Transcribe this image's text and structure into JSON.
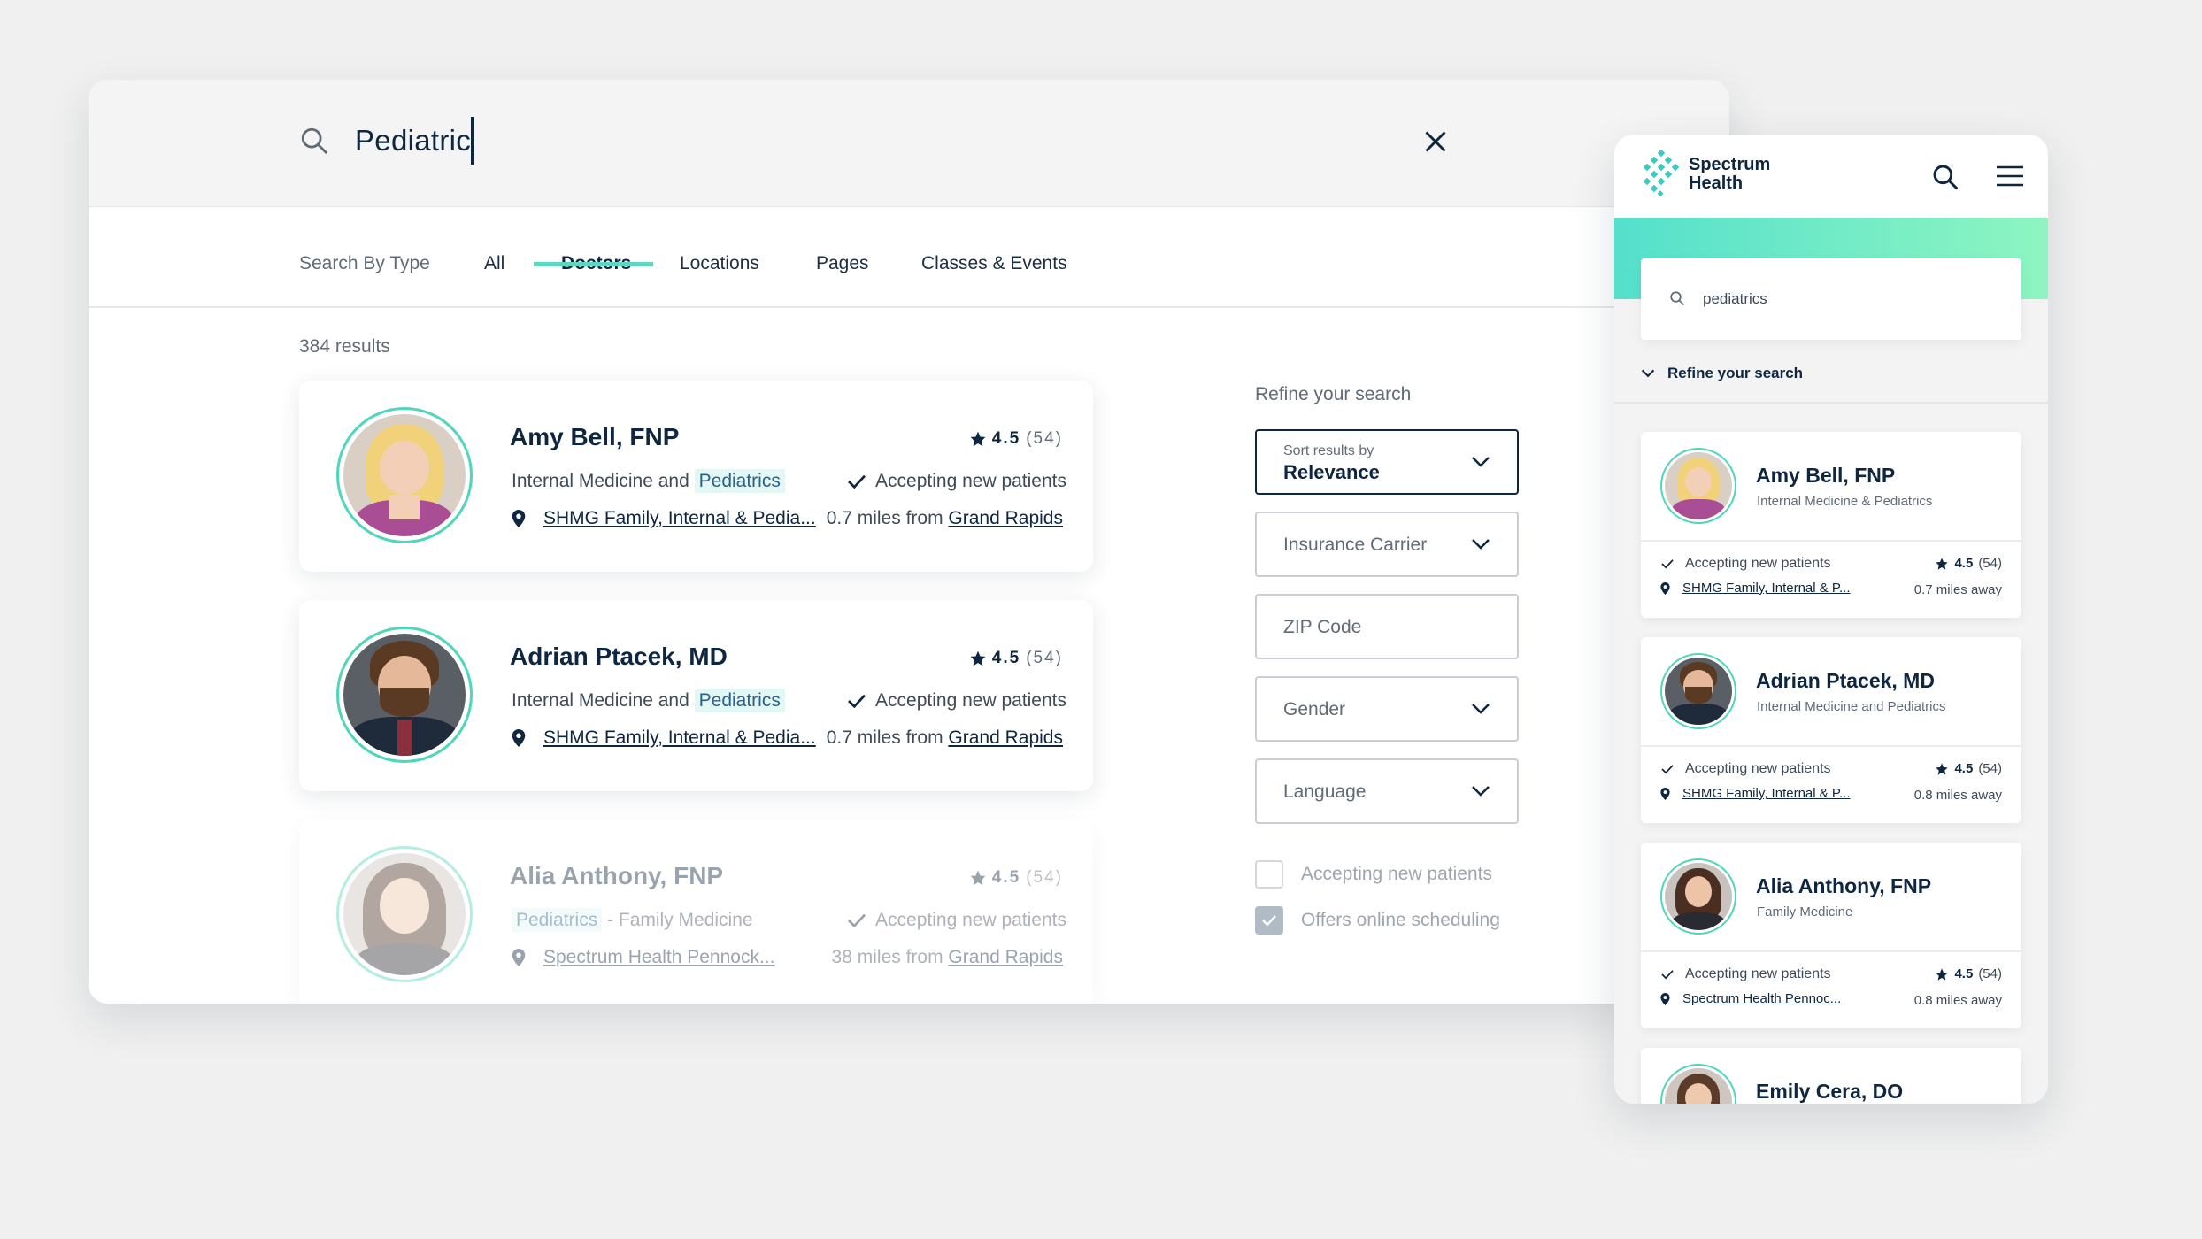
{
  "desktop": {
    "search": {
      "value": "Pediatric"
    },
    "tabs": {
      "label": "Search By Type",
      "items": [
        "All",
        "Doctors",
        "Locations",
        "Pages",
        "Classes & Events"
      ],
      "active": "Doctors"
    },
    "results_count": "384 results",
    "cards": [
      {
        "name": "Amy Bell, FNP",
        "rating": "4.5",
        "reviews": "(54)",
        "spec_pre": "Internal Medicine and",
        "spec_hl": "Pediatrics",
        "spec_post": "",
        "accepting": "Accepting new patients",
        "location": "SHMG Family, Internal & Pedia...",
        "distance": "0.7 miles from",
        "city": "Grand Rapids"
      },
      {
        "name": "Adrian Ptacek, MD",
        "rating": "4.5",
        "reviews": "(54)",
        "spec_pre": "Internal Medicine and",
        "spec_hl": "Pediatrics",
        "spec_post": "",
        "accepting": "Accepting new patients",
        "location": "SHMG Family, Internal & Pedia...",
        "distance": "0.7 miles from",
        "city": "Grand Rapids"
      },
      {
        "name": "Alia Anthony, FNP",
        "rating": "4.5",
        "reviews": "(54)",
        "spec_pre": "",
        "spec_hl": "Pediatrics",
        "spec_post": "- Family Medicine",
        "accepting": "Accepting new patients",
        "location": "Spectrum Health Pennock...",
        "distance": "38 miles from",
        "city": "Grand Rapids"
      }
    ],
    "refine": {
      "title": "Refine your search",
      "sort_label": "Sort results by",
      "sort_value": "Relevance",
      "insurance": "Insurance Carrier",
      "zip": "ZIP Code",
      "gender": "Gender",
      "language": "Language",
      "accepting": "Accepting new patients",
      "online": "Offers online scheduling"
    }
  },
  "mobile": {
    "brand_line1": "Spectrum",
    "brand_line2": "Health",
    "search_value": "pediatrics",
    "refine": "Refine your search",
    "cards": [
      {
        "name": "Amy Bell, FNP",
        "spec": "Internal Medicine & Pediatrics",
        "accepting": "Accepting new patients",
        "rating": "4.5",
        "reviews": "(54)",
        "location": "SHMG Family, Internal & P...",
        "distance": "0.7 miles away"
      },
      {
        "name": "Adrian Ptacek, MD",
        "spec": "Internal Medicine and Pediatrics",
        "accepting": "Accepting new patients",
        "rating": "4.5",
        "reviews": "(54)",
        "location": "SHMG Family, Internal & P...",
        "distance": "0.8 miles away"
      },
      {
        "name": "Alia Anthony, FNP",
        "spec": "Family Medicine",
        "accepting": "Accepting new patients",
        "rating": "4.5",
        "reviews": "(54)",
        "location": "Spectrum Health Pennoc...",
        "distance": "0.8 miles away"
      },
      {
        "name": "Emily Cera, DO"
      }
    ]
  },
  "colors": {
    "navy": "#0f2640",
    "accent": "#5cd8c0",
    "highlight": "#e3f7f4"
  }
}
